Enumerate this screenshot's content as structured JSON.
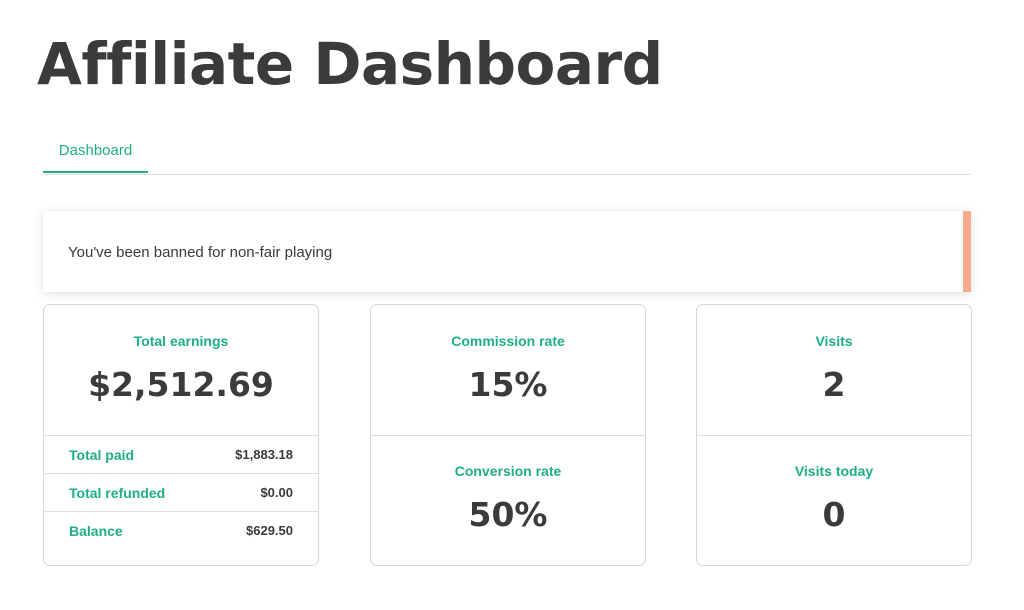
{
  "header": {
    "title": "Affiliate Dashboard"
  },
  "tabs": [
    {
      "label": "Dashboard",
      "active": true
    }
  ],
  "notice": {
    "message": "You've been banned for non-fair playing",
    "accent_color": "#f7a98c"
  },
  "cards": {
    "earnings": {
      "label": "Total earnings",
      "value": "$2,512.69",
      "rows": [
        {
          "label": "Total paid",
          "value": "$1,883.18"
        },
        {
          "label": "Total refunded",
          "value": "$0.00"
        },
        {
          "label": "Balance",
          "value": "$629.50"
        }
      ]
    },
    "rates": {
      "top": {
        "label": "Commission rate",
        "value": "15%"
      },
      "bottom": {
        "label": "Conversion rate",
        "value": "50%"
      }
    },
    "visits": {
      "top": {
        "label": "Visits",
        "value": "2"
      },
      "bottom": {
        "label": "Visits today",
        "value": "0"
      }
    }
  },
  "colors": {
    "accent": "#1fae85",
    "text": "#3b3b3b",
    "border": "#d6d6d6"
  }
}
